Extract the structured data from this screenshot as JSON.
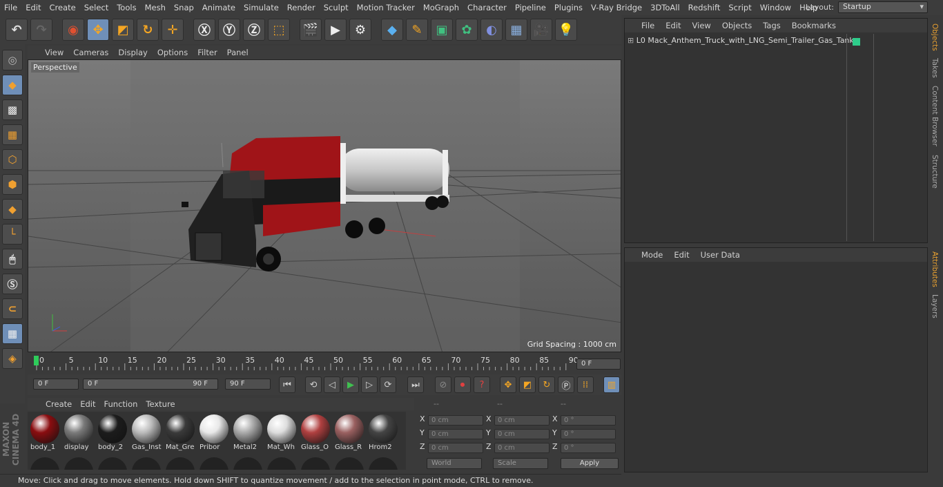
{
  "menu": [
    "File",
    "Edit",
    "Create",
    "Select",
    "Tools",
    "Mesh",
    "Snap",
    "Animate",
    "Simulate",
    "Render",
    "Sculpt",
    "Motion Tracker",
    "MoGraph",
    "Character",
    "Pipeline",
    "Plugins",
    "V-Ray Bridge",
    "3DToAll",
    "Redshift",
    "Script",
    "Window",
    "Help"
  ],
  "layout": {
    "label": "Layout:",
    "value": "Startup"
  },
  "viewport": {
    "menu": [
      "View",
      "Cameras",
      "Display",
      "Options",
      "Filter",
      "Panel"
    ],
    "label": "Perspective",
    "grid_spacing": "Grid Spacing : 1000 cm"
  },
  "timeline": {
    "ticks": [
      "0",
      "5",
      "10",
      "15",
      "20",
      "25",
      "30",
      "35",
      "40",
      "45",
      "50",
      "55",
      "60",
      "65",
      "70",
      "75",
      "80",
      "85",
      "90"
    ],
    "current_frame": "0 F",
    "start": "0 F",
    "range_start": "0 F",
    "range_end": "90 F",
    "end": "90 F"
  },
  "materials": {
    "menu": [
      "Create",
      "Edit",
      "Function",
      "Texture"
    ],
    "items": [
      {
        "name": "body_1",
        "color": "#8a0d10"
      },
      {
        "name": "display",
        "color": "#7a7a7a"
      },
      {
        "name": "body_2",
        "color": "#1c1c1c"
      },
      {
        "name": "Gas_Inst",
        "color": "#bbbbbb"
      },
      {
        "name": "Mat_Gre",
        "color": "#3a3a3a"
      },
      {
        "name": "Pribor",
        "color": "#e8e8e8"
      },
      {
        "name": "Metal2",
        "color": "#aaaaaa"
      },
      {
        "name": "Mat_Wh",
        "color": "#dddddd"
      },
      {
        "name": "Glass_O",
        "color": "#b04040"
      },
      {
        "name": "Glass_R",
        "color": "#9a6060"
      },
      {
        "name": "Hrom2",
        "color": "#444444"
      }
    ]
  },
  "coords": {
    "headers": [
      "--",
      "--",
      "--"
    ],
    "rows": [
      {
        "a": "X",
        "av": "0 cm",
        "b": "X",
        "bv": "0 cm",
        "c": "X",
        "cv": "0 °"
      },
      {
        "a": "Y",
        "av": "0 cm",
        "b": "Y",
        "bv": "0 cm",
        "c": "Y",
        "cv": "0 °"
      },
      {
        "a": "Z",
        "av": "0 cm",
        "b": "Z",
        "bv": "0 cm",
        "c": "Z",
        "cv": "0 °"
      }
    ],
    "world": "World",
    "scale": "Scale",
    "apply": "Apply"
  },
  "objects": {
    "menu": [
      "File",
      "Edit",
      "View",
      "Objects",
      "Tags",
      "Bookmarks"
    ],
    "item": "Mack_Anthem_Truck_with_LNG_Semi_Trailer_Gas_Tank"
  },
  "attributes": {
    "menu": [
      "Mode",
      "Edit",
      "User Data"
    ]
  },
  "side_tabs": [
    "Objects",
    "Takes",
    "Content Browser",
    "Structure",
    "Attributes",
    "Layers"
  ],
  "status": "Move: Click and drag to move elements. Hold down SHIFT to quantize movement / add to the selection in point mode, CTRL to remove.",
  "brand": "MAXON CINEMA 4D"
}
